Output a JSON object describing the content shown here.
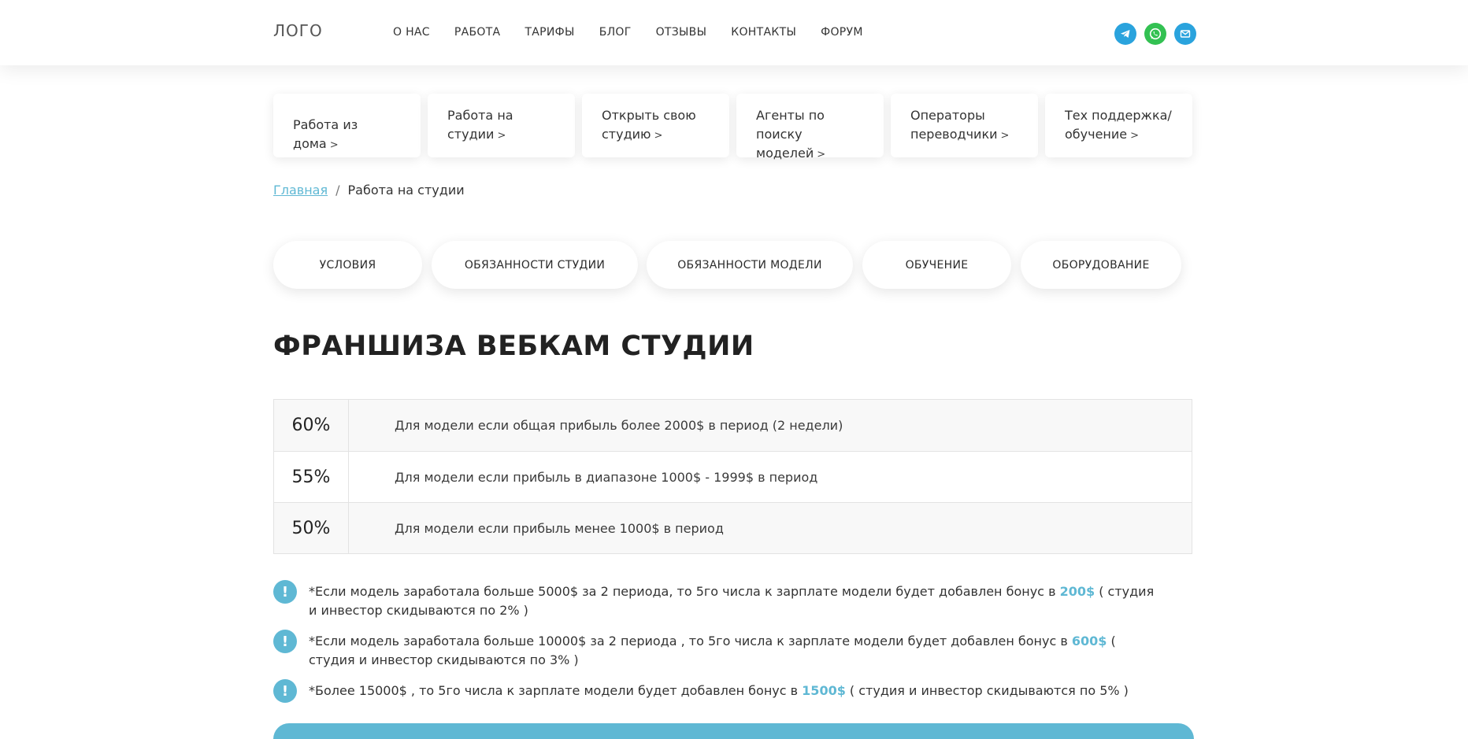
{
  "header": {
    "logo": "ЛОГО",
    "nav": [
      "О НАС",
      "РАБОТА",
      "ТАРИФЫ",
      "БЛОГ",
      "ОТЗЫВЫ",
      "КОНТАКТЫ",
      "ФОРУМ"
    ],
    "social": [
      {
        "icon": "telegram-icon",
        "color": "#2aa3dd"
      },
      {
        "icon": "whatsapp-icon",
        "color": "#33c152"
      },
      {
        "icon": "email-icon",
        "color": "#2aa3dd"
      }
    ]
  },
  "categories": [
    {
      "line1": "Работа из дома",
      "line2": ""
    },
    {
      "line1": "Работа на",
      "line2": "студии"
    },
    {
      "line1": "Открыть свою",
      "line2": "студию"
    },
    {
      "line1": "Агенты по поиску",
      "line2": "моделей"
    },
    {
      "line1": "Операторы",
      "line2": "переводчики"
    },
    {
      "line1": "Тех поддержка/",
      "line2": "обучение"
    }
  ],
  "breadcrumb": {
    "home": "Главная",
    "separator": "/",
    "current": "Работа на студии"
  },
  "tabs": [
    "УСЛОВИЯ",
    "ОБЯЗАННОСТИ СТУДИИ",
    "ОБЯЗАННОСТИ МОДЕЛИ",
    "ОБУЧЕНИЕ",
    "ОБОРУДОВАНИЕ"
  ],
  "title": "ФРАНШИЗА ВЕБКАМ СТУДИИ",
  "rates": [
    {
      "percent": "60%",
      "text": "Для модели если общая прибыль более 2000$ в период (2 недели)"
    },
    {
      "percent": "55%",
      "text": "Для модели если прибыль в диапазоне 1000$ - 1999$ в период"
    },
    {
      "percent": "50%",
      "text": "Для модели если прибыль менее 1000$ в период"
    }
  ],
  "notes": [
    {
      "before": "*Если модель заработала больше 5000$ за 2 периода, то 5го числа к зарплате модели будет добавлен бонус в ",
      "bonus": "200$",
      "after": " ( студия и инвестор скидываются по 2% )"
    },
    {
      "before": "*Если модель заработала больше 10000$ за 2 периода , то 5го числа к зарплате модели будет добавлен бонус в ",
      "bonus": "600$",
      "after": " ( студия и инвестор скидываются по 3% )"
    },
    {
      "before": "*Более 15000$ , то 5го числа к зарплате модели будет добавлен бонус в ",
      "bonus": "1500$",
      "after": " ( студия и инвестор скидываются по 5% )"
    }
  ],
  "note_icon": "!",
  "accent_color": "#5fb8d4"
}
